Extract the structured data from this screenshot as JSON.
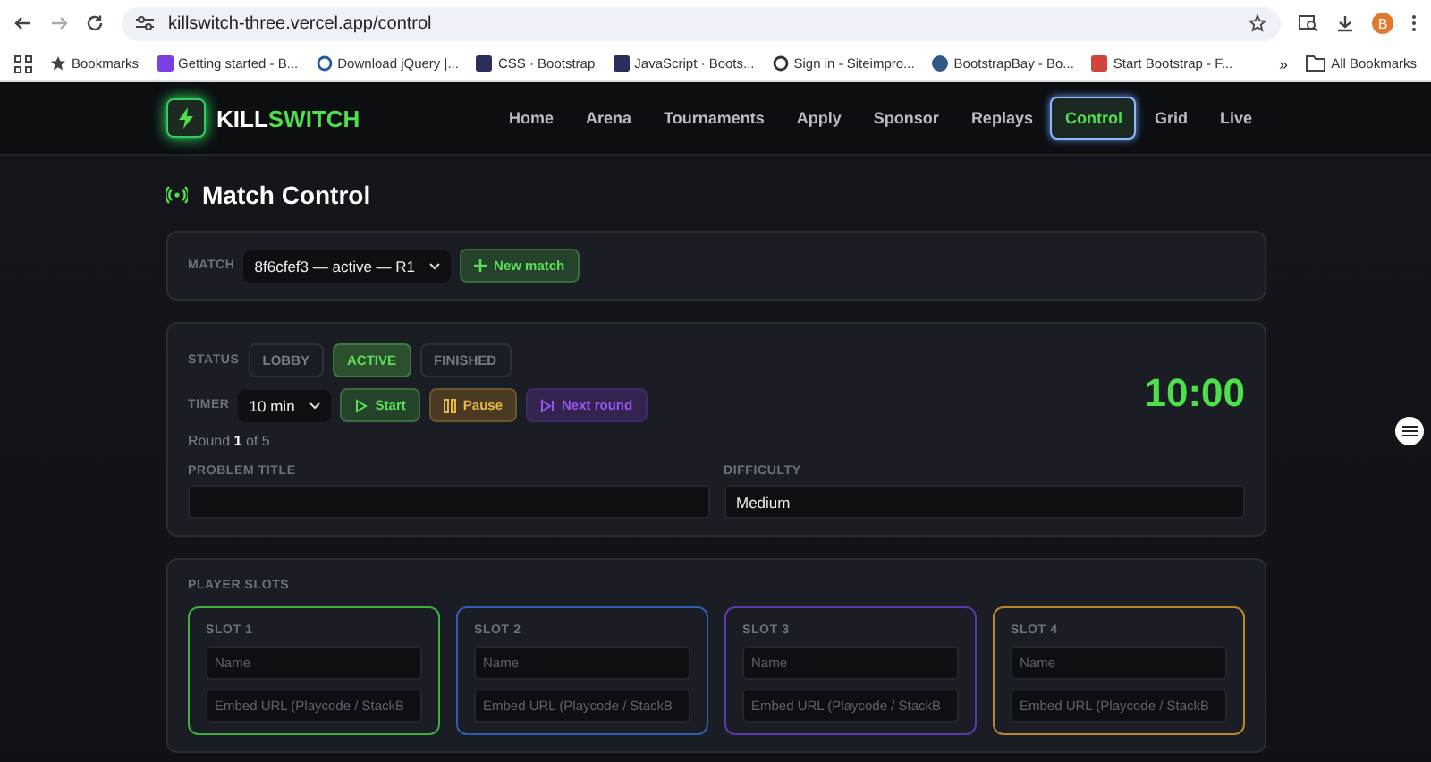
{
  "browser": {
    "url": "killswitch-three.vercel.app/control",
    "profile": "B",
    "bookmarks": [
      {
        "label": "Bookmarks",
        "kind": "star"
      },
      {
        "label": "Getting started - B...",
        "kind": "favicon",
        "color": "#7b3fe4"
      },
      {
        "label": "Download jQuery |...",
        "kind": "ring",
        "color": "#1e5aa8"
      },
      {
        "label": "CSS · Bootstrap",
        "kind": "favicon",
        "color": "#2b2d5c"
      },
      {
        "label": "JavaScript · Boots...",
        "kind": "favicon",
        "color": "#2b2d5c"
      },
      {
        "label": "Sign in - Siteimpro...",
        "kind": "ring",
        "color": "#333333"
      },
      {
        "label": "BootstrapBay - Bo...",
        "kind": "round",
        "color": "#2f5a86"
      },
      {
        "label": "Start Bootstrap - F...",
        "kind": "favicon",
        "color": "#d0453b"
      }
    ],
    "more": "»",
    "all_bookmarks": "All Bookmarks"
  },
  "nav": {
    "brand_first": "KILL",
    "brand_second": "SWITCH",
    "links": [
      {
        "label": "Home",
        "selected": false
      },
      {
        "label": "Arena",
        "selected": false
      },
      {
        "label": "Tournaments",
        "selected": false
      },
      {
        "label": "Apply",
        "selected": false
      },
      {
        "label": "Sponsor",
        "selected": false
      },
      {
        "label": "Replays",
        "selected": false
      },
      {
        "label": "Control",
        "selected": true
      },
      {
        "label": "Grid",
        "selected": false
      },
      {
        "label": "Live",
        "selected": false
      }
    ]
  },
  "page_title": "Match Control",
  "match": {
    "label": "MATCH",
    "value": "8f6cfef3 — active — R1",
    "new_button": "New match"
  },
  "control": {
    "status_label": "STATUS",
    "statuses": [
      {
        "label": "LOBBY",
        "selected": false
      },
      {
        "label": "ACTIVE",
        "selected": true
      },
      {
        "label": "FINISHED",
        "selected": false
      }
    ],
    "timer_label": "TIMER",
    "timer_value": "10 min",
    "actions": [
      {
        "label": "Start",
        "kind": "start"
      },
      {
        "label": "Pause",
        "kind": "pause"
      },
      {
        "label": "Next round",
        "kind": "next"
      }
    ],
    "clock": "10:00",
    "round": "Round **1** of 5",
    "fields": [
      {
        "label": "PROBLEM TITLE"
      },
      {
        "label": "DIFFICULTY",
        "value": "Medium"
      }
    ]
  },
  "slots": {
    "title": "PLAYER SLOTS",
    "items": [
      {
        "label": "SLOT 1",
        "color": "#3fae3a",
        "name_placeholder": "Name",
        "embed_placeholder": "Embed URL (Playcode / StackB"
      },
      {
        "label": "SLOT 2",
        "color": "#2f5db0",
        "name_placeholder": "Name",
        "embed_placeholder": "Embed URL (Playcode / StackB"
      },
      {
        "label": "SLOT 3",
        "color": "#5b3aa8",
        "name_placeholder": "Name",
        "embed_placeholder": "Embed URL (Playcode / StackB"
      },
      {
        "label": "SLOT 4",
        "color": "#b8862a",
        "name_placeholder": "Name",
        "embed_placeholder": "Embed URL (Playcode / StackB"
      }
    ]
  }
}
